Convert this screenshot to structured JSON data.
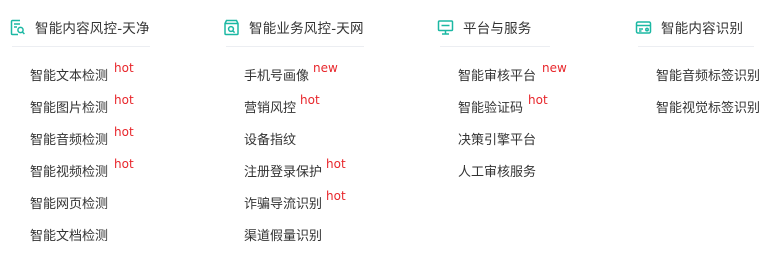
{
  "accent_color": "#1bb8a3",
  "badge_color": "#e8262b",
  "columns": [
    {
      "icon": "content-audit-icon",
      "title": "智能内容风控-天净",
      "items": [
        {
          "label": "智能文本检测",
          "badge": "hot"
        },
        {
          "label": "智能图片检测",
          "badge": "hot"
        },
        {
          "label": "智能音频检测",
          "badge": "hot"
        },
        {
          "label": "智能视频检测",
          "badge": "hot"
        },
        {
          "label": "智能网页检测",
          "badge": ""
        },
        {
          "label": "智能文档检测",
          "badge": ""
        }
      ]
    },
    {
      "icon": "business-risk-icon",
      "title": "智能业务风控-天网",
      "items": [
        {
          "label": "手机号画像",
          "badge": "new"
        },
        {
          "label": "营销风控",
          "badge": "hot"
        },
        {
          "label": "设备指纹",
          "badge": ""
        },
        {
          "label": "注册登录保护",
          "badge": "hot"
        },
        {
          "label": "诈骗导流识别",
          "badge": "hot"
        },
        {
          "label": "渠道假量识别",
          "badge": ""
        }
      ]
    },
    {
      "icon": "monitor-icon",
      "title": "平台与服务",
      "items": [
        {
          "label": "智能审核平台",
          "badge": "new"
        },
        {
          "label": "智能验证码",
          "badge": "hot"
        },
        {
          "label": "决策引擎平台",
          "badge": ""
        },
        {
          "label": "人工审核服务",
          "badge": ""
        }
      ]
    },
    {
      "icon": "id-card-icon",
      "title": "智能内容识别",
      "items": [
        {
          "label": "智能音频标签识别",
          "badge": ""
        },
        {
          "label": "智能视觉标签识别",
          "badge": ""
        }
      ]
    }
  ]
}
